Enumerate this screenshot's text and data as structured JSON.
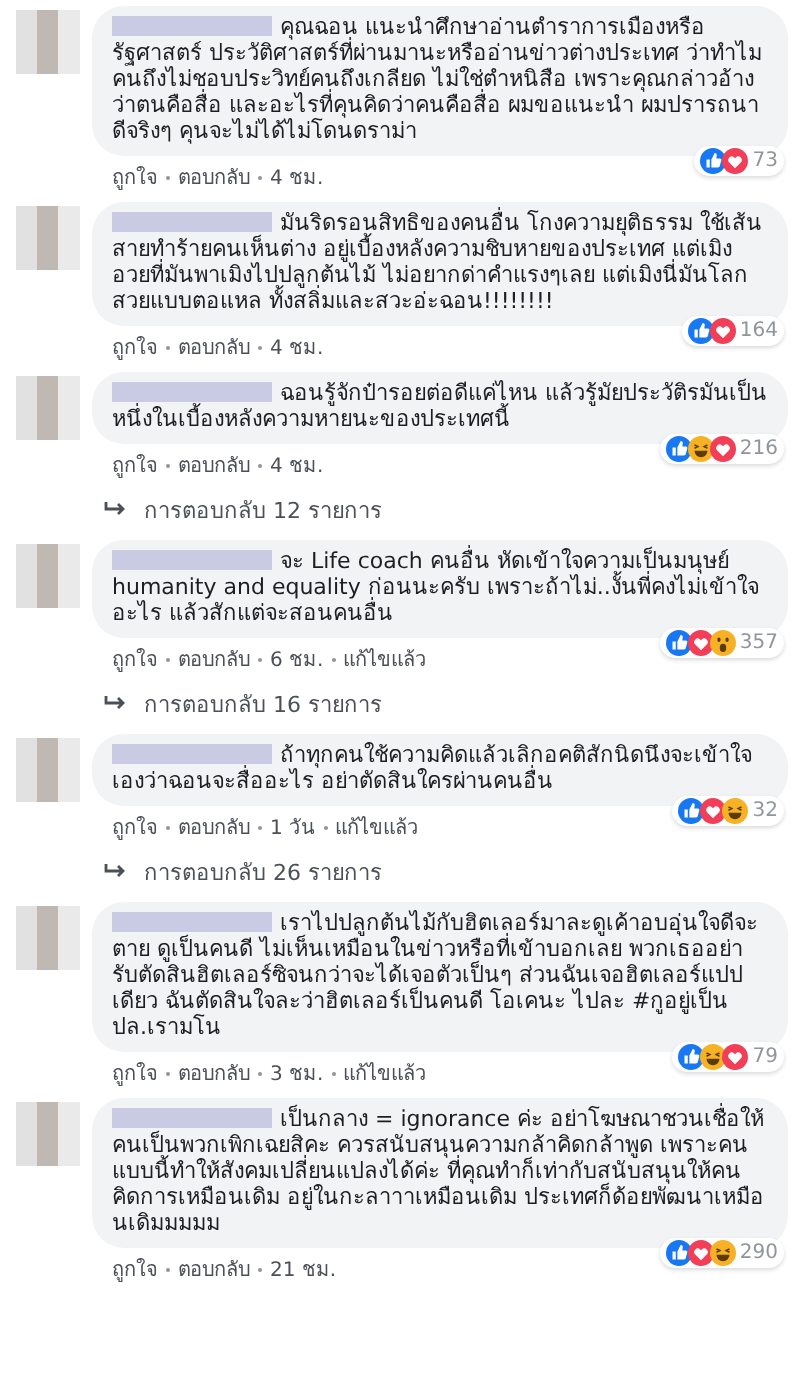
{
  "comments": [
    {
      "text": "คุณฉอน แนะนำศึกษาอ่านตำราการเมืองหรือรัฐศาสตร์ ประวัติศาสตร์ที่ผ่านมานะหรืออ่านข่าวต่างประเทศ ว่าทำไมคนถึงไม่ชอบประวิทย์คนถึงเกลียด ไม่ใช่ตำหนิสือ เพราะคุณกล่าวอ้างว่าตนคือสื่อ และอะไรที่คุนคิดว่าคนคือสื่อ ผมขอแนะนำ ผมปรารถนาดีจริงๆ คุนจะไม่ได้ไม่โดนดราม่า",
      "reactions": [
        {
          "kind": "like"
        },
        {
          "kind": "love"
        }
      ],
      "count": "73",
      "actions": [
        "ถูกใจ",
        "ตอบกลับ",
        "4 ชม."
      ]
    },
    {
      "text": "มันริดรอนสิทธิของคนอื่น โกงความยุติธรรม ใช้เส้นสายทำร้ายคนเห็นต่าง อยู่เบื้องหลังความชิบหายของประเทศ แต่เมิงอวยที่มันพาเมิงไปปลูกต้นไม้ ไม่อยากด่าคำแรงๆเลย แต่เมิงนี่มันโลกสวยแบบตอแหล ทั้งสลิ่มและสวะอ่ะฉอน!!!!!!!!",
      "reactions": [
        {
          "kind": "like"
        },
        {
          "kind": "love"
        }
      ],
      "count": "164",
      "actions": [
        "ถูกใจ",
        "ตอบกลับ",
        "4 ชม."
      ]
    },
    {
      "text": "ฉอนรู้จักป๋ารอยต่อดีแค่ไหน แล้วรู้มัยประวัติรมันเป็นหนึ่งในเบื้องหลังความหายนะของประเทศนี้",
      "reactions": [
        {
          "kind": "like"
        },
        {
          "kind": "haha"
        },
        {
          "kind": "love"
        }
      ],
      "count": "216",
      "actions": [
        "ถูกใจ",
        "ตอบกลับ",
        "4 ชม."
      ],
      "replies": "การตอบกลับ 12 รายการ"
    },
    {
      "text": "จะ Life coach คนอื่น หัดเข้าใจความเป็นมนุษย์ humanity and equality ก่อนนะครับ เพราะถ้าไม่..งั้นพี่คงไม่เข้าใจอะไร แล้วสักแต่จะสอนคนอื่น",
      "reactions": [
        {
          "kind": "like"
        },
        {
          "kind": "love"
        },
        {
          "kind": "wow"
        }
      ],
      "count": "357",
      "actions": [
        "ถูกใจ",
        "ตอบกลับ",
        "6 ชม.",
        "แก้ไขแล้ว"
      ],
      "replies": "การตอบกลับ 16 รายการ"
    },
    {
      "text": "ถ้าทุกคนใช้ความคิดแล้วเลิกอคติสักนิดนึงจะเข้าใจเองว่าฉอนจะสื่ออะไร อย่าตัดสินใครผ่านคนอื่น",
      "reactions": [
        {
          "kind": "like"
        },
        {
          "kind": "love"
        },
        {
          "kind": "haha"
        }
      ],
      "count": "32",
      "actions": [
        "ถูกใจ",
        "ตอบกลับ",
        "1 วัน",
        "แก้ไขแล้ว"
      ],
      "replies": "การตอบกลับ 26 รายการ"
    },
    {
      "text": "เราไปปลูกต้นไม้กับฮิตเลอร์มาละดูเค้าอบอุ่นใจดีจะตาย ดูเป็นคนดี ไม่เห็นเหมือนในข่าวหรือที่เข้าบอกเลย พวกเธออย่ารับตัดสินฮิตเลอร์ซิจนกว่าจะได้เจอตัวเป็นๆ ส่วนฉันเจอฮิตเลอร์แปปเดียว ฉันตัดสินใจละว่าฮิตเลอร์เป็นคนดี โอเคนะ ไปละ #กูอยู่เป็น ปล.เรามโน",
      "reactions": [
        {
          "kind": "like"
        },
        {
          "kind": "haha"
        },
        {
          "kind": "love"
        }
      ],
      "count": "79",
      "actions": [
        "ถูกใจ",
        "ตอบกลับ",
        "3 ชม.",
        "แก้ไขแล้ว"
      ]
    },
    {
      "text": "เป็นกลาง = ignorance ค่ะ อย่าโฆษณาชวนเชื่อให้คนเป็นพวกเพิกเฉยสิคะ ควรสนับสนุนความกล้าคิดกล้าพูด เพราะคนแบบนี้ทำให้สังคมเปลี่ยนแปลงได้ค่ะ ที่คุณทำก็เท่ากับสนับสนุนให้คนคิดการเหมือนเดิม อยู่ในกะลาาาเหมือนเดิม ประเทศก็ด้อยพัฒนาเหมือนเดิมมมมม",
      "reactions": [
        {
          "kind": "like"
        },
        {
          "kind": "love"
        },
        {
          "kind": "haha"
        }
      ],
      "count": "290",
      "actions": [
        "ถูกใจ",
        "ตอบกลับ",
        "21 ชม."
      ]
    }
  ]
}
